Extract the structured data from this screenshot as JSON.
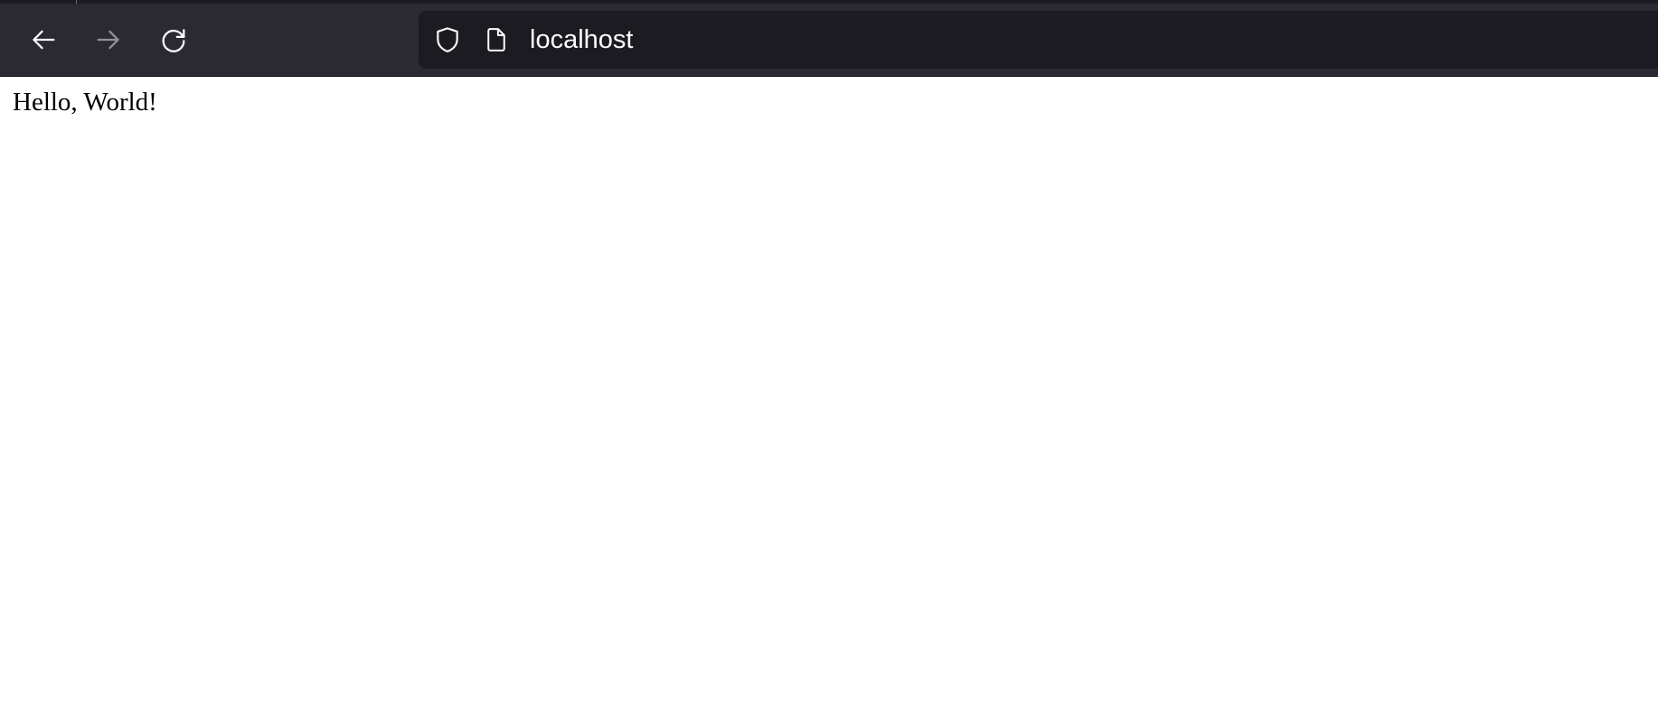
{
  "toolbar": {
    "back_icon": "arrow-left-icon",
    "forward_icon": "arrow-right-icon",
    "forward_disabled": true,
    "reload_icon": "reload-icon"
  },
  "urlbar": {
    "security_icon": "shield-icon",
    "page_icon": "document-icon",
    "url": "localhost"
  },
  "page": {
    "text": "Hello, World!"
  },
  "colors": {
    "toolbar_bg": "#2b2a33",
    "urlbar_bg": "#1c1b22",
    "icon": "#fbfbfe",
    "icon_disabled": "#8f8f9d",
    "page_bg": "#ffffff",
    "text": "#000000"
  }
}
